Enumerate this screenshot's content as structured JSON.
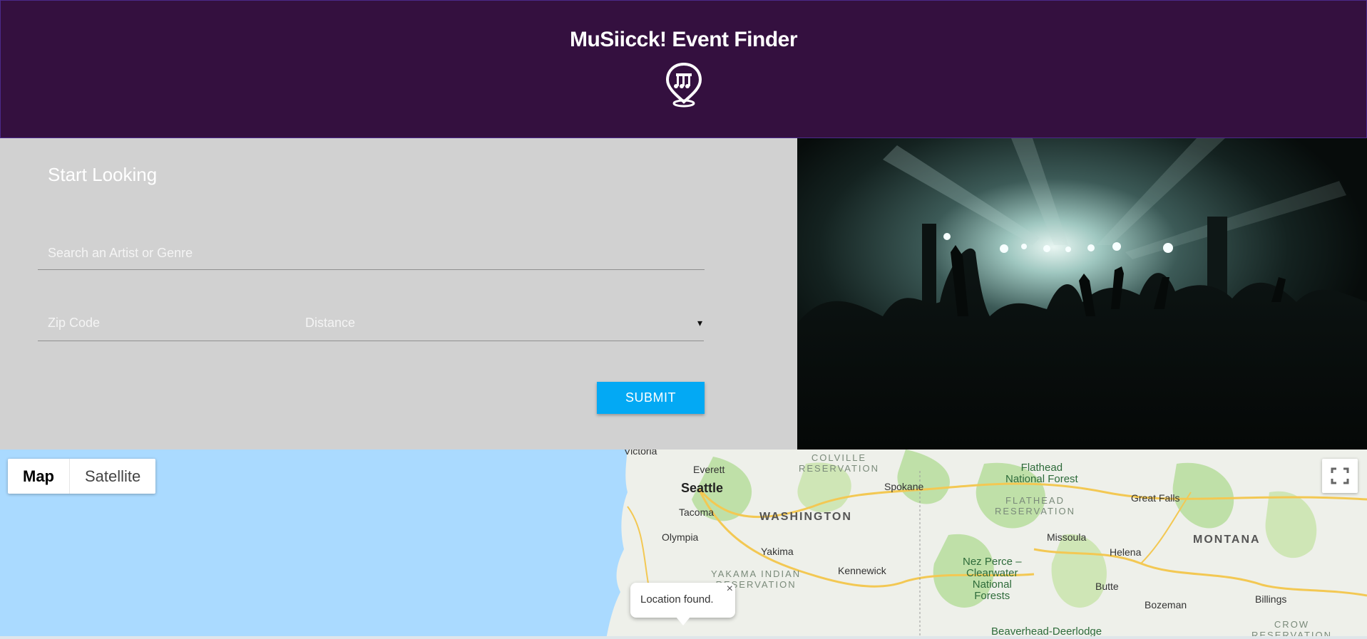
{
  "header": {
    "title": "MuSiicck! Event Finder",
    "logo_icon": "map-pin-music-icon",
    "background": "#34103f"
  },
  "form": {
    "heading": "Start Looking",
    "search_placeholder": "Search an Artist or Genre",
    "zip_placeholder": "Zip Code",
    "distance_label": "Distance",
    "distance_caret": "▾",
    "submit_label": "SUBMIT",
    "submit_color": "#03a9f4"
  },
  "photo": {
    "subject": "concert-crowd"
  },
  "map": {
    "type_map": "Map",
    "type_satellite": "Satellite",
    "fullscreen_icon": "fullscreen-icon",
    "labels": {
      "victoria": "Victoria",
      "colville": "COLVILLE\nRESERVATION",
      "everett": "Everett",
      "seattle": "Seattle",
      "tacoma": "Tacoma",
      "olympia": "Olympia",
      "washington": "WASHINGTON",
      "spokane": "Spokane",
      "flathead_forest": "Flathead\nNational Forest",
      "flathead_res": "FLATHEAD\nRESERVATION",
      "great_falls": "Great Falls",
      "yakima": "Yakima",
      "yakama": "YAKAMA INDIAN\nRESERVATION",
      "kennewick": "Kennewick",
      "nez_perce": "Nez Perce –\nClearwater\nNational\nForests",
      "missoula": "Missoula",
      "helena": "Helena",
      "montana": "MONTANA",
      "butte": "Butte",
      "bozeman": "Bozeman",
      "billings": "Billings",
      "crow": "CROW\nRESERVATION",
      "beaverhead": "Beaverhead-Deerlodge"
    },
    "info_window": {
      "text": "Location found.",
      "close": "×"
    }
  }
}
